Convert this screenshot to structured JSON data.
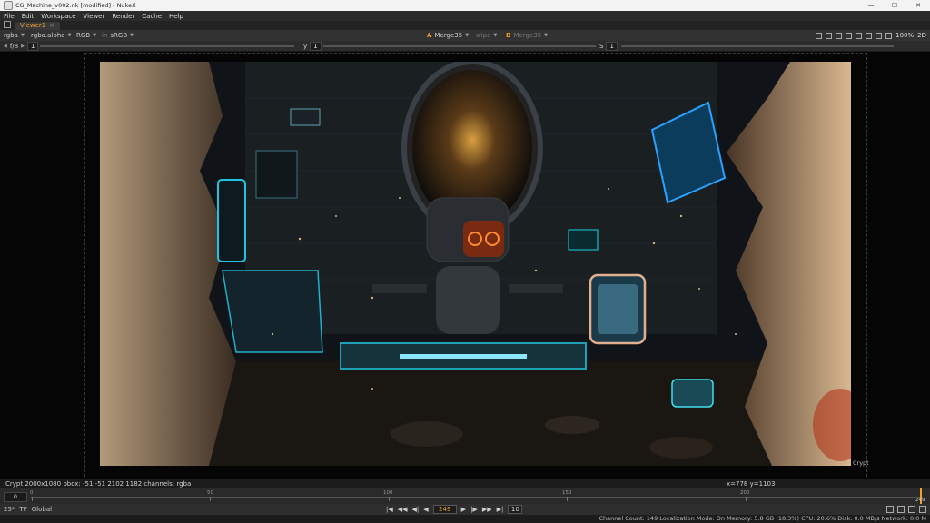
{
  "window": {
    "title": "CG_Machine_v002.nk [modified] - NukeX",
    "controls": [
      "—",
      "☐",
      "✕"
    ]
  },
  "menu": [
    "File",
    "Edit",
    "Workspace",
    "Viewer",
    "Render",
    "Cache",
    "Help"
  ],
  "tab": {
    "label": "Viewer1",
    "close": "×"
  },
  "toolbar1": {
    "channels": "rgba",
    "alpha": "rgba.alpha",
    "display": "RGB",
    "lut_prefix": "in",
    "lut": "sRGB",
    "input_a_letter": "A",
    "input_a": "Merge35",
    "wipe": "wipe",
    "input_b_letter": "B",
    "input_b": "Merge35",
    "zoom": "100%",
    "view": "2D",
    "s_label": "S",
    "s_value": "1"
  },
  "toolbar2": {
    "fstop": "f/8",
    "gain": "1",
    "y_label": "y",
    "y_value": "1"
  },
  "viewer": {
    "overlay_label": "Crypt"
  },
  "info": {
    "left": "Crypt 2000x1080  bbox: -51 -51 2102 1182 channels: rgba",
    "right": "x=778 y=1103"
  },
  "timeline": {
    "start": "0",
    "ticks": [
      "0",
      "50",
      "100",
      "150",
      "200"
    ],
    "end": "249"
  },
  "controls": {
    "fps": "25*",
    "tf": "TF",
    "global": "Global",
    "current_frame": "249",
    "step": "10",
    "transport": [
      "|◀",
      "◀◀",
      "◀|",
      "◀",
      "▶",
      "|▶",
      "▶▶",
      "▶|"
    ]
  },
  "status": "Channel Count: 149 Localization Mode: On Memory: 5.8 GB (18.3%) CPU: 20.6% Disk: 0.0 MB/s Network: 0.0 M"
}
